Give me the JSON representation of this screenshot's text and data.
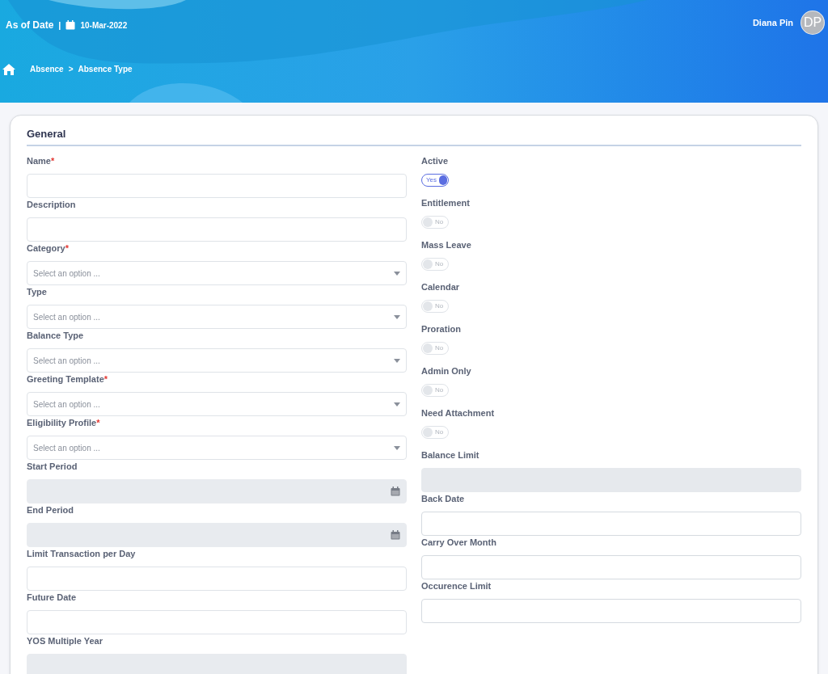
{
  "header": {
    "as_of_label": "As of Date",
    "separator": "|",
    "date": "10-Mar-2022",
    "user_name": "Diana Pin",
    "avatar_initials": "DP"
  },
  "breadcrumb": {
    "items": [
      "Absence",
      "Absence Type"
    ],
    "separator": ">"
  },
  "section": {
    "title": "General"
  },
  "required_mark": "*",
  "left_fields": [
    {
      "label": "Name",
      "required": true,
      "kind": "text",
      "disabled": false
    },
    {
      "label": "Description",
      "required": false,
      "kind": "text",
      "disabled": false
    },
    {
      "label": "Category",
      "required": true,
      "kind": "select",
      "disabled": false,
      "placeholder": "Select an option ..."
    },
    {
      "label": "Type",
      "required": false,
      "kind": "select",
      "disabled": false,
      "placeholder": "Select an option ..."
    },
    {
      "label": "Balance Type",
      "required": false,
      "kind": "select",
      "disabled": false,
      "placeholder": "Select an option ..."
    },
    {
      "label": "Greeting Template",
      "required": true,
      "kind": "select",
      "disabled": false,
      "placeholder": "Select an option ..."
    },
    {
      "label": "Eligibility Profile",
      "required": true,
      "kind": "select",
      "disabled": false,
      "placeholder": "Select an option ..."
    },
    {
      "label": "Start Period",
      "required": false,
      "kind": "date",
      "disabled": true
    },
    {
      "label": "End Period",
      "required": false,
      "kind": "date",
      "disabled": true
    },
    {
      "label": "Limit Transaction per Day",
      "required": false,
      "kind": "text",
      "disabled": false
    },
    {
      "label": "Future Date",
      "required": false,
      "kind": "text",
      "disabled": false
    },
    {
      "label": "YOS Multiple Year",
      "required": false,
      "kind": "text",
      "disabled": true
    }
  ],
  "right_fields": [
    {
      "label": "Active",
      "kind": "toggle",
      "on": true,
      "text": "Yes"
    },
    {
      "label": "Entitlement",
      "kind": "toggle",
      "on": false,
      "text": "No"
    },
    {
      "label": "Mass Leave",
      "kind": "toggle",
      "on": false,
      "text": "No"
    },
    {
      "label": "Calendar",
      "kind": "toggle",
      "on": false,
      "text": "No"
    },
    {
      "label": "Proration",
      "kind": "toggle",
      "on": false,
      "text": "No"
    },
    {
      "label": "Admin Only",
      "kind": "toggle",
      "on": false,
      "text": "No"
    },
    {
      "label": "Need Attachment",
      "kind": "toggle",
      "on": false,
      "text": "No"
    },
    {
      "label": "Balance Limit",
      "kind": "text",
      "disabled": true
    },
    {
      "label": "Back Date",
      "kind": "text",
      "disabled": false
    },
    {
      "label": "Carry Over Month",
      "kind": "text",
      "disabled": false
    },
    {
      "label": "Occurence Limit",
      "kind": "text",
      "disabled": false
    }
  ]
}
